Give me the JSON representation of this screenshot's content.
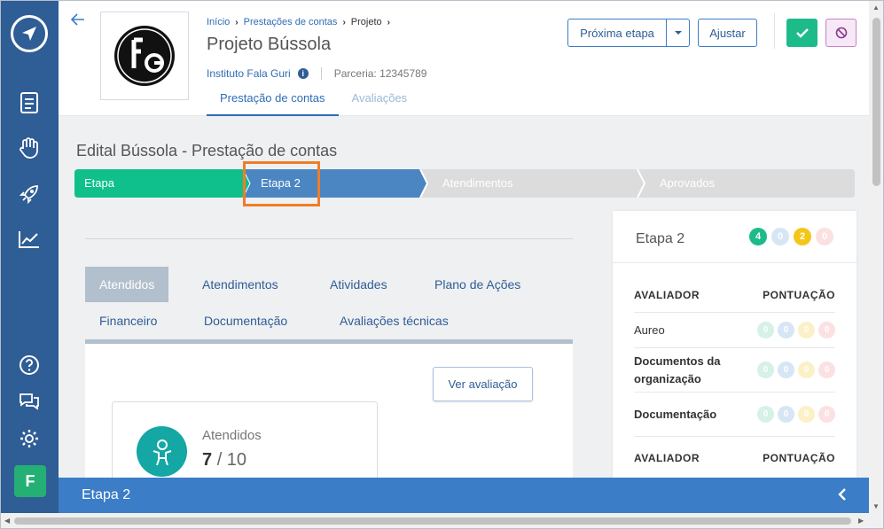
{
  "sidebar": {
    "avatar_letter": "F",
    "icons": [
      "compass-icon",
      "document-icon",
      "hand-heart-icon",
      "rocket-icon",
      "chart-icon",
      "help-icon",
      "chat-icon",
      "gear-icon"
    ]
  },
  "header": {
    "breadcrumb": [
      "Início",
      "Prestações de contas",
      "Projeto"
    ],
    "title": "Projeto Bússola",
    "institution": "Instituto Fala Guri",
    "partnership": "Parceria: 12345789",
    "tabs": [
      "Prestação de contas",
      "Avaliações"
    ],
    "next_step_label": "Próxima etapa",
    "adjust_label": "Ajustar"
  },
  "main": {
    "section_title": "Edital Bússola - Prestação de contas",
    "stepper": [
      "Etapa",
      "Etapa 2",
      "Atendimentos",
      "Aprovados"
    ],
    "inner_tabs": [
      "Atendidos",
      "Atendimentos",
      "Atividades",
      "Plano de Ações",
      "Financeiro",
      "Documentação",
      "Avaliações técnicas"
    ],
    "view_button": "Ver avaliação",
    "card": {
      "label": "Atendidos",
      "count": "7",
      "total": "/ 10"
    }
  },
  "right_panel": {
    "title": "Etapa 2",
    "badges": [
      "4",
      "0",
      "2",
      "0"
    ],
    "header_evaluator": "AVALIADOR",
    "header_score": "PONTUAÇÃO",
    "rows": [
      {
        "label": "Aureo",
        "scores": [
          "0",
          "0",
          "0",
          "0"
        ]
      },
      {
        "label": "Documentos da organização",
        "scores": [
          "0",
          "0",
          "0",
          "0"
        ]
      },
      {
        "label": "Documentação",
        "scores": [
          "0",
          "0",
          "0",
          "0"
        ]
      }
    ]
  },
  "bottom_bar": {
    "title": "Etapa 2"
  },
  "colors": {
    "sidebar": "#2f5d95",
    "primary": "#3b7dc6",
    "green": "#1dbb8a",
    "highlight": "#f07d26"
  }
}
